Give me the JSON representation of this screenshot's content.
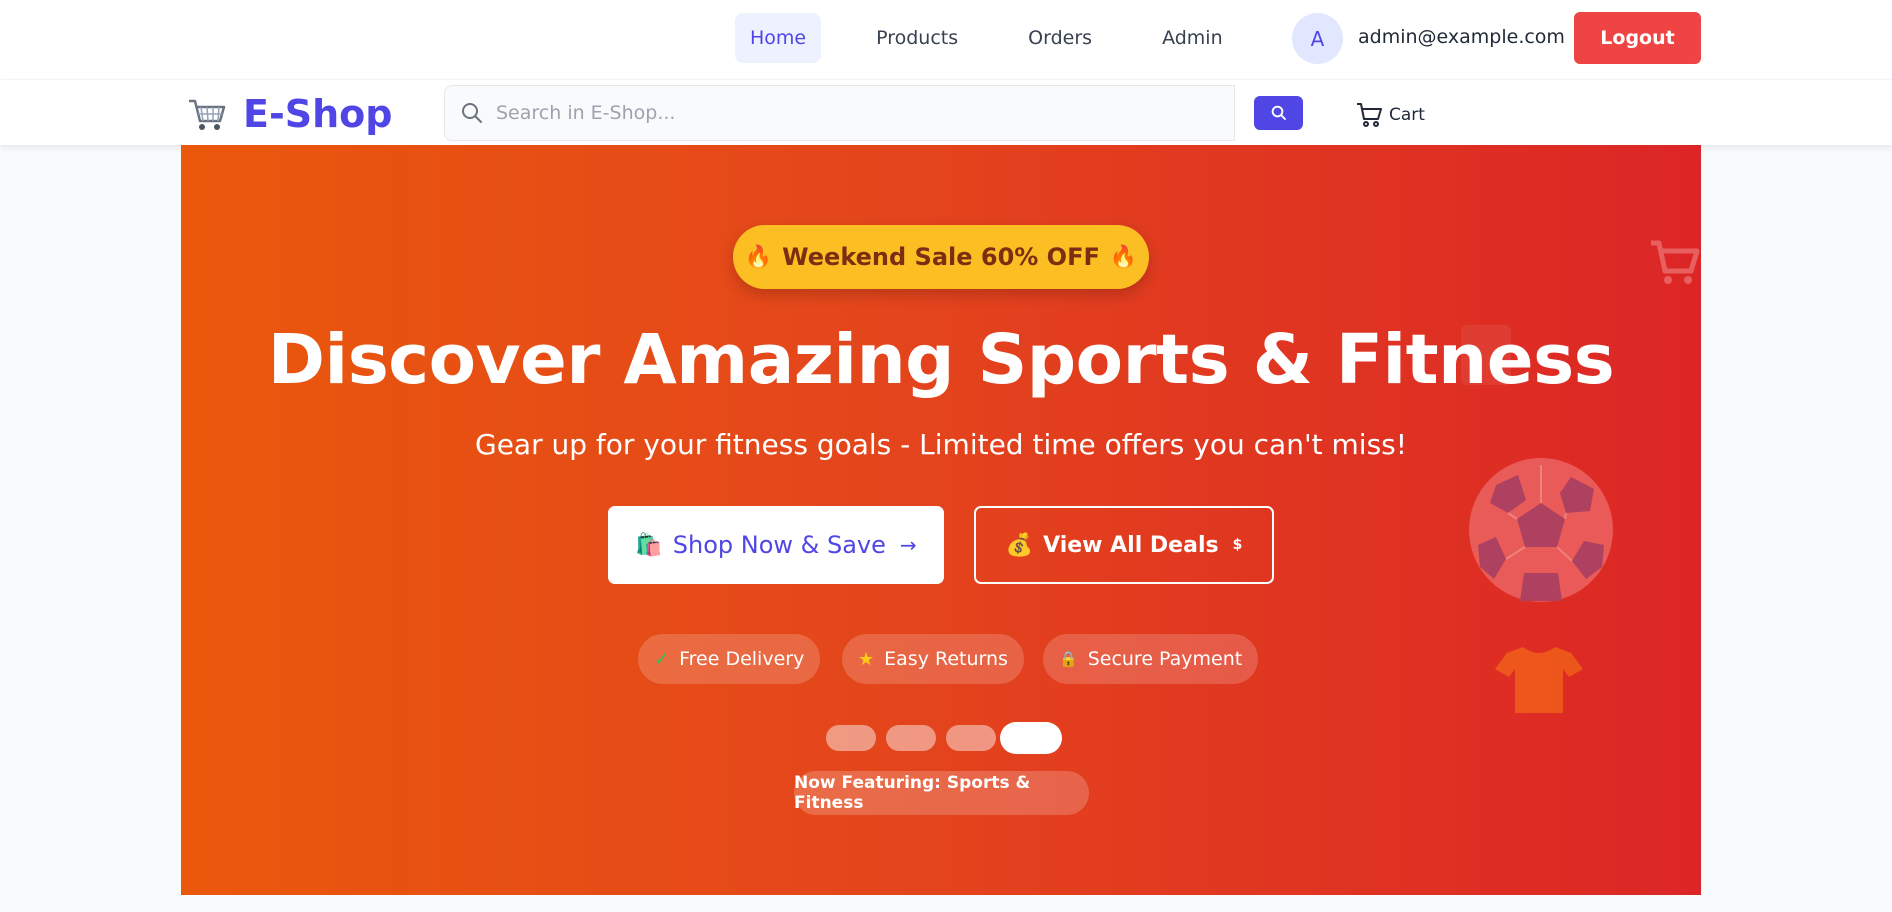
{
  "nav": {
    "items": [
      {
        "label": "Home",
        "active": true
      },
      {
        "label": "Products"
      },
      {
        "label": "Orders"
      },
      {
        "label": "Admin"
      }
    ],
    "user_initial": "A",
    "user_email": "admin@example.com",
    "logout_label": "Logout"
  },
  "brand": {
    "name": "E-Shop",
    "logo_icon": "shopping-cart-icon",
    "color": "#4f46e5"
  },
  "search": {
    "placeholder": "Search in E-Shop...",
    "value": ""
  },
  "cart": {
    "label": "Cart"
  },
  "hero": {
    "badge": "Weekend Sale 60% OFF",
    "badge_icon": "🔥",
    "title": "Discover Amazing Sports & Fitness",
    "subtitle": "Gear up for your fitness goals - Limited time offers you can't miss!",
    "shop_button": {
      "label": "Shop Now & Save",
      "icon": "🛍️",
      "trail": "→"
    },
    "deals_button": {
      "label": "View All Deals",
      "icon": "💰",
      "trail": "$"
    },
    "features": [
      {
        "label": "Free Delivery",
        "icon": "✓"
      },
      {
        "label": "Easy Returns",
        "icon": "★"
      },
      {
        "label": "Secure Payment",
        "icon": "🔒"
      }
    ],
    "slides": {
      "count": 4,
      "active_index": 3
    },
    "featuring": "Now Featuring: Sports & Fitness",
    "gradient": [
      "#ea580c",
      "#dc2626"
    ]
  },
  "colors": {
    "logout": "#ef4444",
    "badge": "#fbbf24",
    "accent": "#4f46e5"
  }
}
